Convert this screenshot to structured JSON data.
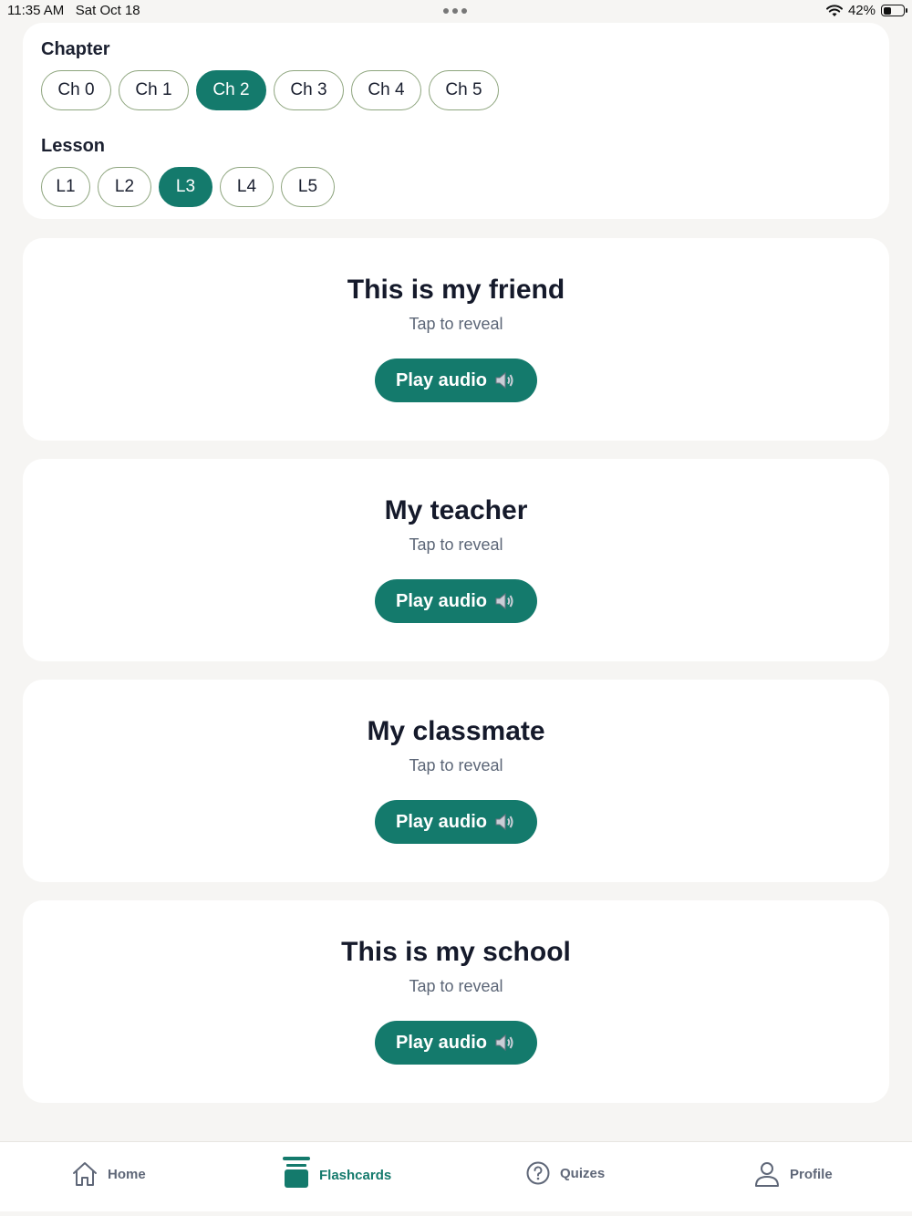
{
  "status_bar": {
    "time": "11:35 AM",
    "date": "Sat Oct 18",
    "battery_percent_label": "42%",
    "battery_level": 0.42
  },
  "filters": {
    "chapter_title": "Chapter",
    "chapters": [
      "Ch 0",
      "Ch 1",
      "Ch 2",
      "Ch 3",
      "Ch 4",
      "Ch 5"
    ],
    "selected_chapter": "Ch 2",
    "lesson_title": "Lesson",
    "lessons": [
      "L1",
      "L2",
      "L3",
      "L4",
      "L5"
    ],
    "selected_lesson": "L3"
  },
  "cards": [
    {
      "title": "This is my friend",
      "hint": "Tap to reveal",
      "button": "Play audio"
    },
    {
      "title": "My teacher",
      "hint": "Tap to reveal",
      "button": "Play audio"
    },
    {
      "title": "My classmate",
      "hint": "Tap to reveal",
      "button": "Play audio"
    },
    {
      "title": "This is my school",
      "hint": "Tap to reveal",
      "button": "Play audio"
    }
  ],
  "nav": {
    "items": [
      {
        "label": "Home",
        "icon": "home-icon"
      },
      {
        "label": "Flashcards",
        "icon": "flashcards-icon"
      },
      {
        "label": "Quizes",
        "icon": "question-circle-icon"
      },
      {
        "label": "Profile",
        "icon": "user-icon"
      }
    ],
    "active": "Flashcards"
  },
  "colors": {
    "accent": "#147a6c",
    "pill_border": "#8ea57e",
    "background": "#f6f5f3"
  }
}
